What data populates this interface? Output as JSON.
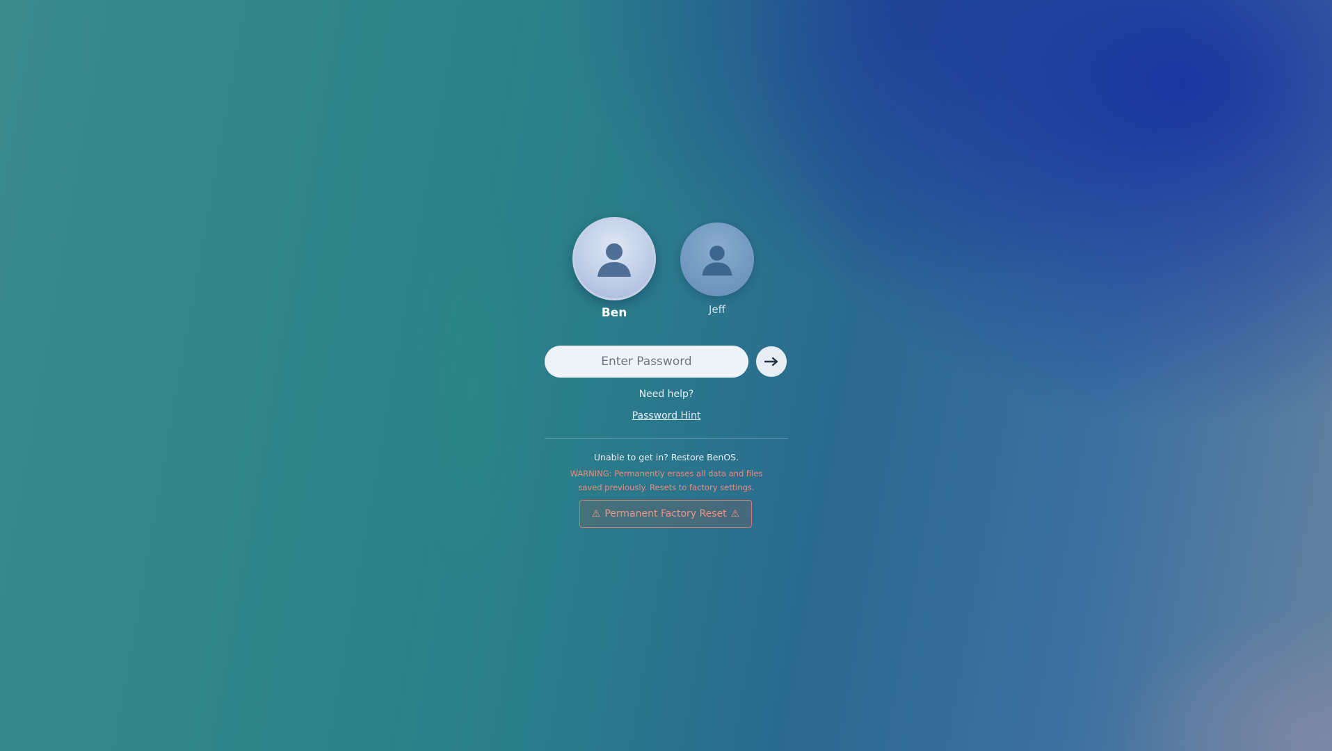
{
  "users": [
    {
      "name": "Ben",
      "icon": "user-silhouette-icon",
      "selected": true
    },
    {
      "name": "Jeff",
      "icon": "user-silhouette-icon",
      "selected": false
    }
  ],
  "password": {
    "placeholder": "Enter Password",
    "value": "",
    "submit_icon": "arrow-right-icon"
  },
  "help": {
    "need_help": "Need help?",
    "hint_link": "Password Hint"
  },
  "restore": {
    "prompt": "Unable to get in? Restore BenOS.",
    "warning": "WARNING: Permanently erases all data and files saved previously. Resets to factory settings.",
    "reset_label": "Permanent Factory Reset",
    "warning_icon": "warning-triangle-icon"
  },
  "colors": {
    "warning": "#f08a7a",
    "background_top_right": "#1a3a9a",
    "background_left": "#3a8a8c"
  }
}
